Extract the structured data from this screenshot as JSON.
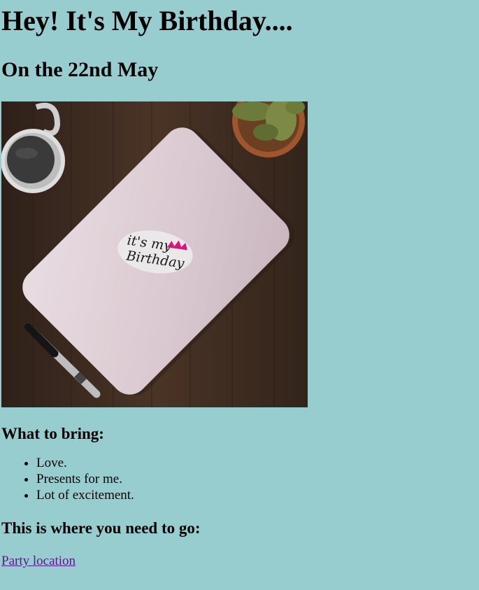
{
  "header": {
    "title": "Hey! It's My Birthday....",
    "subtitle": "On the 22nd May"
  },
  "image": {
    "sticker_line1": "it's my",
    "sticker_line2": "Birthday",
    "icons": [
      "coffee-mug",
      "cactus-pot",
      "laptop",
      "marker-pen",
      "crown-icon"
    ],
    "colors": {
      "wood": "#3b2a20",
      "laptop": "#dcccd2",
      "crown": "#d8157a"
    }
  },
  "bring": {
    "heading": "What to bring:",
    "items": [
      "Love.",
      "Presents for me.",
      "Lot of excitement."
    ]
  },
  "location": {
    "heading": "This is where you need to go:",
    "link_label": "Party location"
  },
  "colors": {
    "background": "#98cdcf",
    "link": "#551a8b"
  }
}
